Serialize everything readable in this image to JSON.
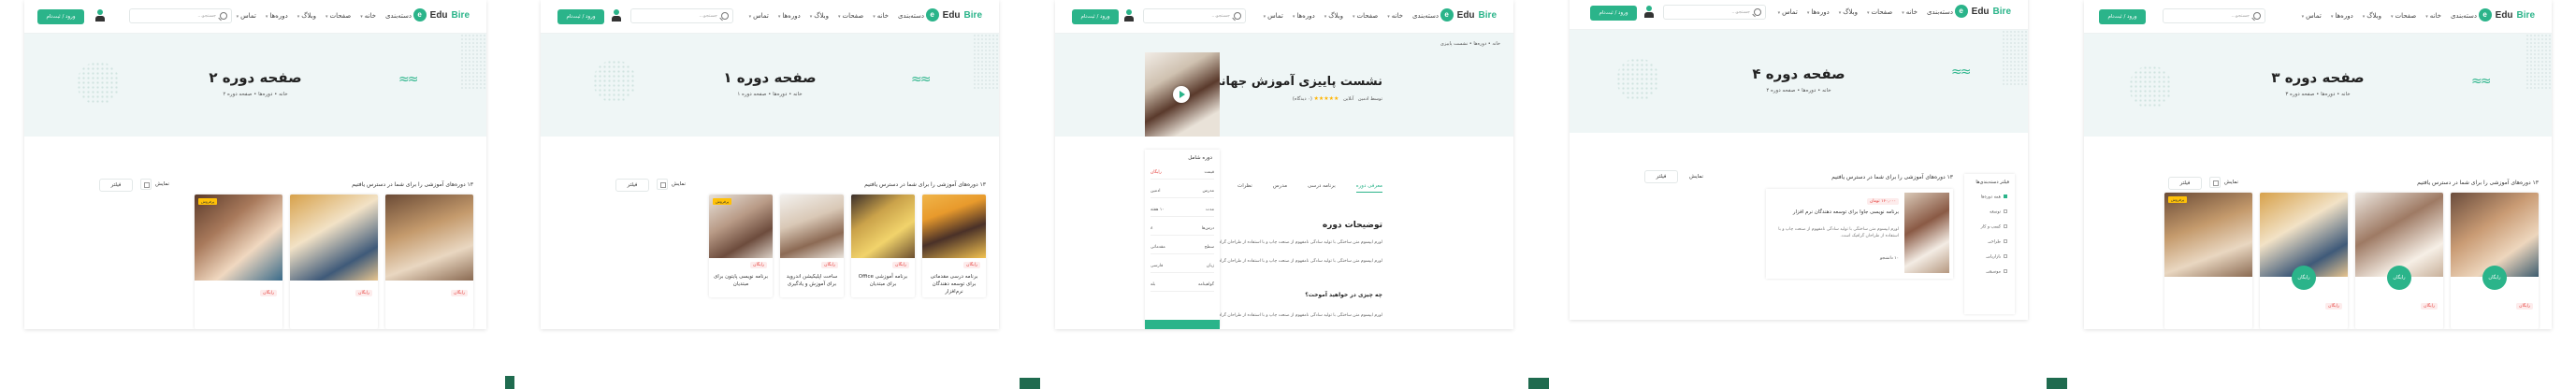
{
  "brand": {
    "name_a": "Edu",
    "name_b": "Bire",
    "accent": "#2bb48a",
    "hero_bg": "#eff6f6"
  },
  "nav": [
    "دسته‌بندی",
    "خانه",
    "صفحات",
    "وبلاگ",
    "دوره‌ها",
    "تماس"
  ],
  "search_placeholder": "جستجو...",
  "login_button": "ورود / ثبت‌نام",
  "screens": [
    {
      "title": "صفحه دوره ۲",
      "breadcrumb": "خانه • دوره‌ها • صفحه دوره ۲"
    },
    {
      "title": "صفحه دوره ۱",
      "breadcrumb": "خانه • دوره‌ها • صفحه دوره ۱"
    },
    {
      "title": "صفحه دوره ۴",
      "breadcrumb": "خانه • دوره‌ها • صفحه دوره ۴"
    },
    {
      "title": "صفحه دوره ۳",
      "breadcrumb": "خانه • دوره‌ها • صفحه دوره ۳"
    }
  ],
  "listing": {
    "heading": "۱۳ دوره‌های آموزشی را برای شما در دسترس یافتیم",
    "sort_label": "نمایش",
    "filter_label": "فیلتر",
    "tag": "پرفروش",
    "badge": "رایگان"
  },
  "cards_s1": [
    {
      "price": "رایگان",
      "title": ""
    },
    {
      "price": "رایگان",
      "title": ""
    },
    {
      "price": "رایگان",
      "title": ""
    }
  ],
  "cards_s2": [
    {
      "price": "رایگان",
      "title": "برنامه درسی مقدماتی برای توسعه دهندگان نرم‌افزار"
    },
    {
      "price": "رایگان",
      "title": "برنامه آموزشی Office برای مبتدیان"
    },
    {
      "price": "رایگان",
      "title": "ساخت اپلیکیشن اندروید برای آموزش و یادگیری"
    },
    {
      "price": "رایگان",
      "title": "برنامه نویسی پایتون برای مبتدیان"
    }
  ],
  "detail": {
    "breadcrumb": "خانه • دوره‌ها • نشست پاییزی",
    "title": "نشست پاییزی آموزش جهانی برای همه",
    "instructor": "توسط ادمین",
    "category": "آنلاین",
    "rating": "★★★★★",
    "rating_count": "(۰ دیدگاه)",
    "tabs": [
      "معرفی دوره",
      "برنامه درسی",
      "مدرس",
      "نظرات"
    ],
    "desc_heading": "توضیحات دوره",
    "desc_text": "لورم ایپسوم متن ساختگی با تولید سادگی نامفهوم از صنعت چاپ و با استفاده از طراحان گرافیک است.",
    "learn_heading": "چه چیزی در خواهید آموخت؟",
    "sidebox_title": "دوره شامل",
    "side_rows": [
      {
        "k": "قیمت",
        "v": "رایگان"
      },
      {
        "k": "مدرس",
        "v": "ادمین"
      },
      {
        "k": "مدت",
        "v": "۱۰ هفته"
      },
      {
        "k": "درس‌ها",
        "v": "۸"
      },
      {
        "k": "سطح",
        "v": "مقدماتی"
      },
      {
        "k": "زبان",
        "v": "فارسی"
      },
      {
        "k": "گواهینامه",
        "v": "بله"
      }
    ]
  },
  "listview": {
    "cat_title": "فیلتر دسته‌بندی‌ها",
    "cats": [
      "همه دوره‌ها",
      "توسعه",
      "کسب و کار",
      "طراحی",
      "بازاریابی",
      "موسیقی"
    ],
    "card_price": "۱۶۰,۰۰۰ تومان",
    "card_title": "برنامه نویسی جاوا برای توسعه دهندگان نرم افزار",
    "card_desc": "لورم ایپسوم متن ساختگی با تولید سادگی نامفهوم از صنعت چاپ و با استفاده از طراحان گرافیک است.",
    "card_meta": "۱۰ دانشجو"
  }
}
